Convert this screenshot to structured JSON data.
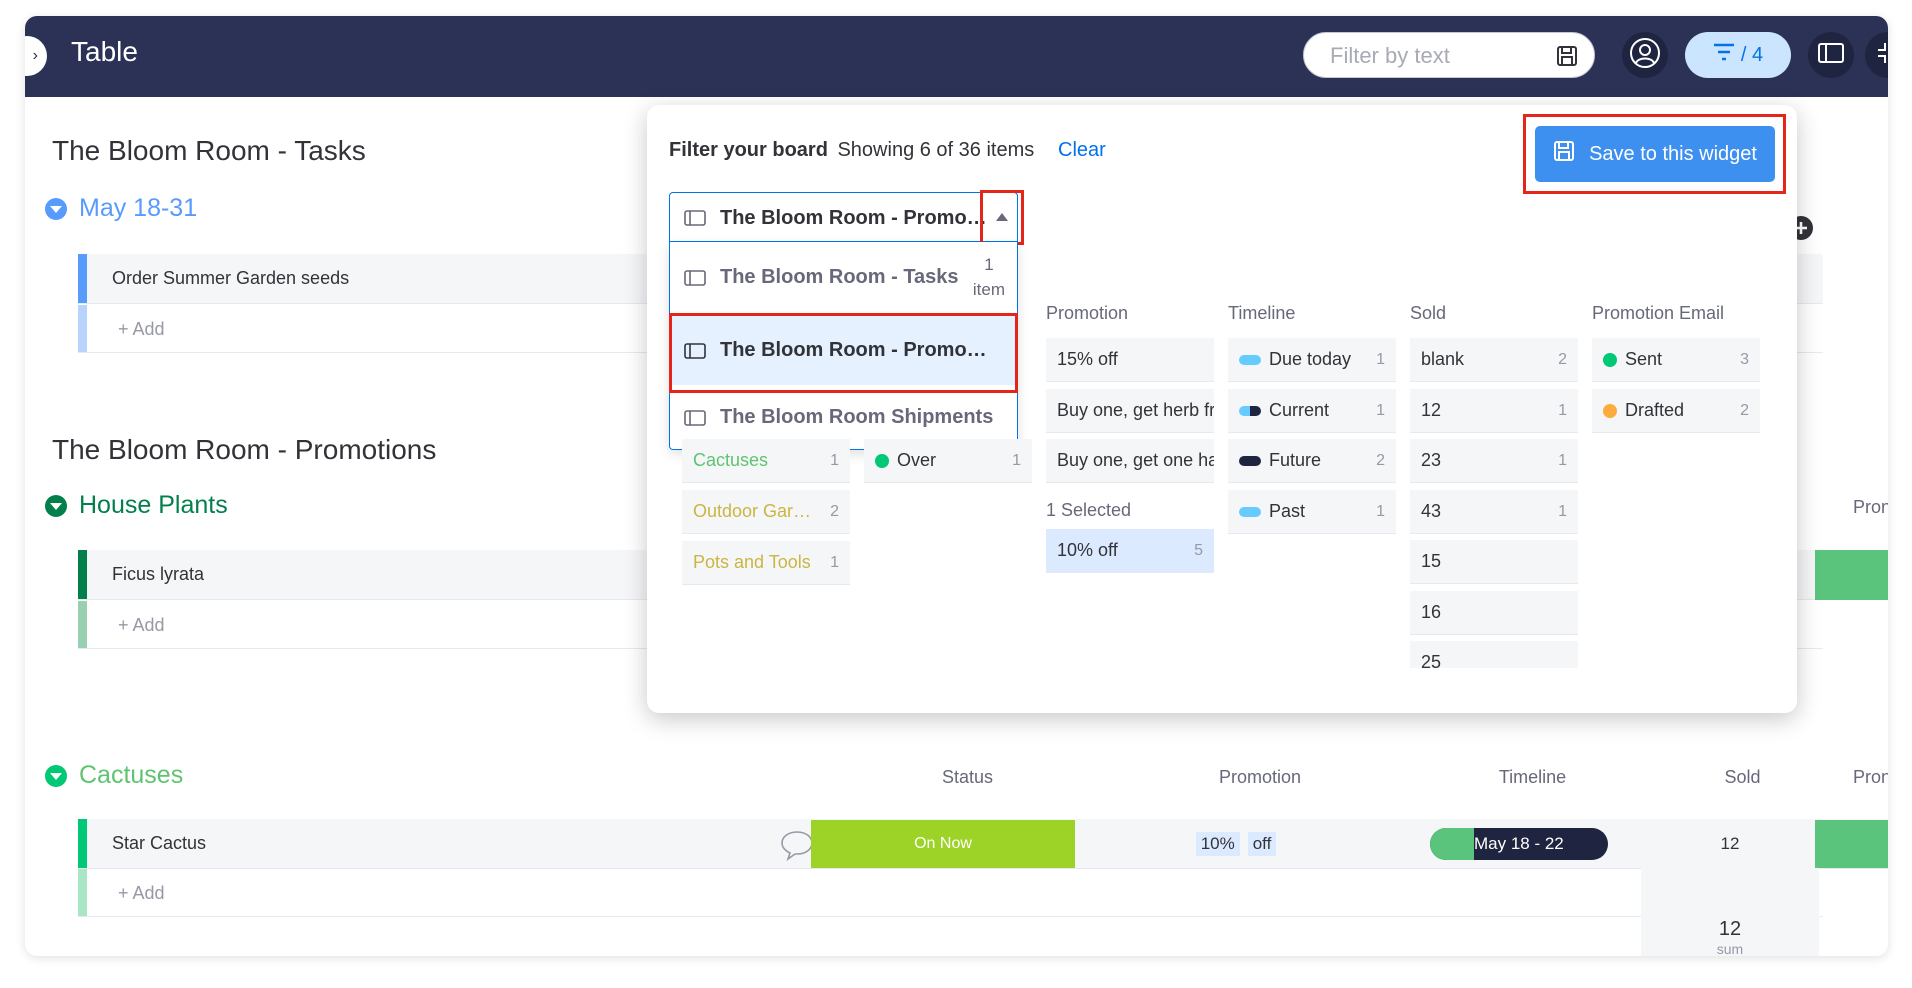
{
  "app": {
    "title": "Table",
    "collapse_glyph": "›",
    "search_placeholder": "Filter by text",
    "filter_count": "/ 4"
  },
  "boards": {
    "tasks": {
      "title": "The Bloom Room - Tasks",
      "group": {
        "name": "May 18-31",
        "color": "#579bfc"
      },
      "rows": [
        {
          "name": "Order Summer Garden seeds"
        }
      ],
      "add_label": "+ Add"
    },
    "promotions": {
      "title": "The Bloom Room - Promotions",
      "groups": [
        {
          "name": "House Plants",
          "color": "#037f4c",
          "rows": [
            {
              "name": "Ficus lyrata"
            }
          ],
          "add_label": "+ Add",
          "partial_header": "Pron"
        },
        {
          "name": "Cactuses",
          "color": "#00c875",
          "text_color": "#5fc471",
          "columns": [
            "Status",
            "Promotion",
            "Timeline",
            "Sold",
            "Pron"
          ],
          "rows": [
            {
              "name": "Star Cactus",
              "status": "On Now",
              "status_color": "#9cd326",
              "promotion_a": "10%",
              "promotion_b": "off",
              "timeline": "May 18 - 22",
              "sold": "12"
            }
          ],
          "add_label": "+ Add",
          "summary": {
            "value": "12",
            "label": "sum"
          }
        }
      ]
    }
  },
  "filter_panel": {
    "title": "Filter your board",
    "showing": "Showing 6 of 36 items",
    "clear_label": "Clear",
    "save_label": "Save to this widget",
    "selected_board": "The Bloom Room - Promotions",
    "board_options": [
      {
        "name": "The Bloom Room - Tasks",
        "count_num": "1",
        "count_unit": "item"
      },
      {
        "name": "The Bloom Room - Promotions",
        "selected": true
      },
      {
        "name": "The Bloom Room Shipments"
      }
    ],
    "group_chips": [
      {
        "label": "Cactuses",
        "count": "1",
        "color": "#5fc471"
      },
      {
        "label": "Outdoor Garden",
        "count": "2",
        "color": "#cab641"
      },
      {
        "label": "Pots and Tools",
        "count": "1",
        "color": "#cab641"
      }
    ],
    "status_chips": [
      {
        "label": "Over",
        "count": "1",
        "color": "#00c875"
      }
    ],
    "promotion": {
      "header": "Promotion",
      "chips": [
        {
          "label": "15% off"
        },
        {
          "label": "Buy one, get herb free"
        },
        {
          "label": "Buy one, get one half off"
        }
      ],
      "selected_header": "1 Selected",
      "selected_chip": {
        "label": "10% off",
        "count": "5"
      }
    },
    "timeline": {
      "header": "Timeline",
      "chips": [
        {
          "label": "Due today",
          "count": "1",
          "color": "#66ccff"
        },
        {
          "label": "Current",
          "count": "1",
          "color": "#1f2440"
        },
        {
          "label": "Future",
          "count": "2",
          "color": "#1f2440"
        },
        {
          "label": "Past",
          "count": "1",
          "color": "#66ccff"
        }
      ]
    },
    "sold": {
      "header": "Sold",
      "chips": [
        {
          "label": "blank",
          "count": "2"
        },
        {
          "label": "12",
          "count": "1"
        },
        {
          "label": "23",
          "count": "1"
        },
        {
          "label": "43",
          "count": "1"
        },
        {
          "label": "15",
          "count": ""
        },
        {
          "label": "16",
          "count": ""
        },
        {
          "label": "25",
          "count": ""
        }
      ]
    },
    "promotion_email": {
      "header": "Promotion Email",
      "chips": [
        {
          "label": "Sent",
          "count": "3",
          "color": "#00c875"
        },
        {
          "label": "Drafted",
          "count": "2",
          "color": "#fdab3d"
        }
      ]
    }
  }
}
